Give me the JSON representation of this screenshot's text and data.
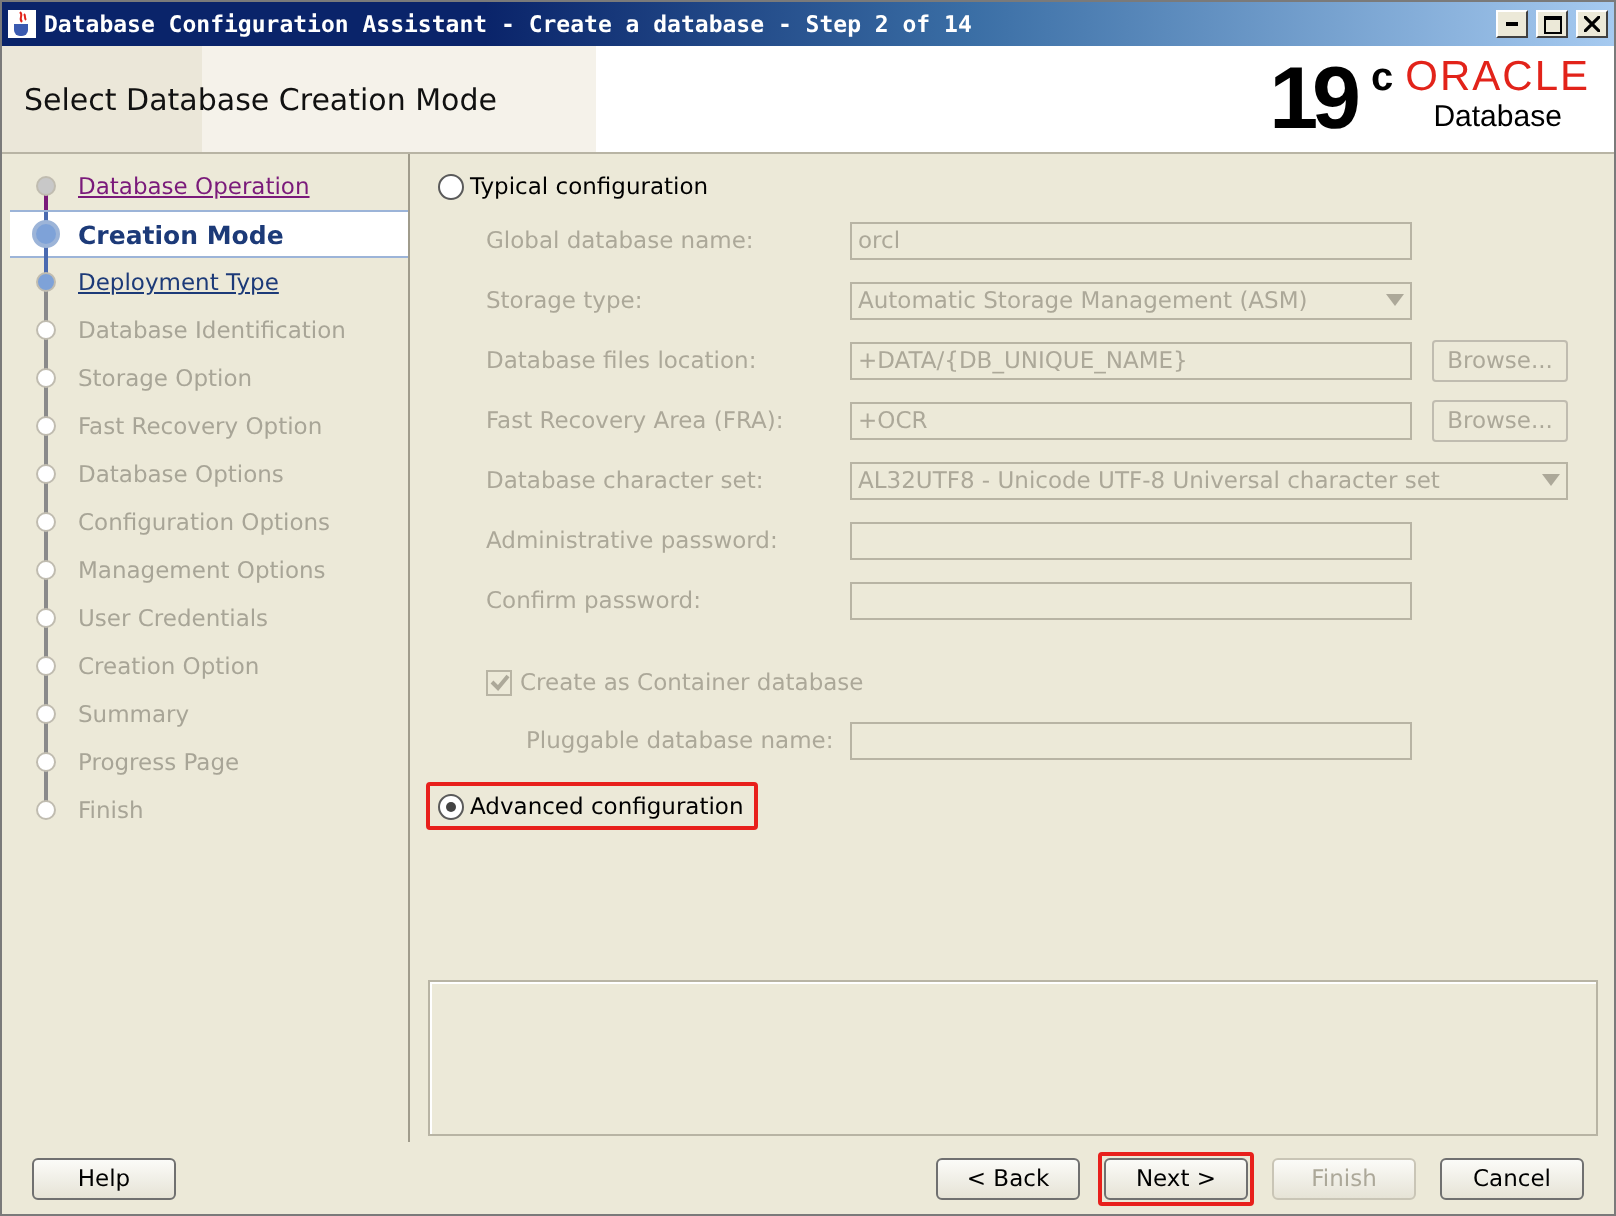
{
  "window": {
    "title": "Database Configuration Assistant - Create a database - Step 2 of 14"
  },
  "header": {
    "title": "Select Database Creation Mode",
    "logo_version": "19",
    "logo_sup": "c",
    "logo_brand": "ORACLE",
    "logo_product": "Database"
  },
  "steps": [
    {
      "label": "Database Operation",
      "kind": "visited"
    },
    {
      "label": "Creation Mode",
      "kind": "current"
    },
    {
      "label": "Deployment Type",
      "kind": "next"
    },
    {
      "label": "Database Identification",
      "kind": "pending"
    },
    {
      "label": "Storage Option",
      "kind": "pending"
    },
    {
      "label": "Fast Recovery Option",
      "kind": "pending"
    },
    {
      "label": "Database Options",
      "kind": "pending"
    },
    {
      "label": "Configuration Options",
      "kind": "pending"
    },
    {
      "label": "Management Options",
      "kind": "pending"
    },
    {
      "label": "User Credentials",
      "kind": "pending"
    },
    {
      "label": "Creation Option",
      "kind": "pending"
    },
    {
      "label": "Summary",
      "kind": "pending"
    },
    {
      "label": "Progress Page",
      "kind": "pending"
    },
    {
      "label": "Finish",
      "kind": "pending"
    }
  ],
  "typical": {
    "label": "Typical configuration",
    "selected": false,
    "highlighted": false
  },
  "fields": [
    {
      "kind": "text",
      "label": "Global database name:",
      "value": "orcl"
    },
    {
      "kind": "select",
      "label": "Storage type:",
      "value": "Automatic Storage Management (ASM)"
    },
    {
      "kind": "browse",
      "label": "Database files location:",
      "value": "+DATA/{DB_UNIQUE_NAME}",
      "button": "Browse..."
    },
    {
      "kind": "browse",
      "label": "Fast Recovery Area (FRA):",
      "value": "+OCR",
      "button": "Browse..."
    },
    {
      "kind": "wideselect",
      "label": "Database character set:",
      "value": "AL32UTF8 - Unicode UTF-8 Universal character set"
    },
    {
      "kind": "text",
      "label": "Administrative password:"
    },
    {
      "kind": "text",
      "label": "Confirm password:"
    }
  ],
  "container": {
    "label": "Create as Container database",
    "checked": true
  },
  "pluggable": {
    "label": "Pluggable database name:"
  },
  "advanced": {
    "label": "Advanced configuration",
    "selected": true,
    "highlighted": true
  },
  "buttons": [
    {
      "label": "Help",
      "disabled": false,
      "highlighted": false
    },
    {
      "label": "< Back",
      "disabled": false,
      "highlighted": false
    },
    {
      "label": "Next >",
      "disabled": false,
      "highlighted": true
    },
    {
      "label": "Finish",
      "disabled": true,
      "highlighted": false
    },
    {
      "label": "Cancel",
      "disabled": false,
      "highlighted": false
    }
  ]
}
